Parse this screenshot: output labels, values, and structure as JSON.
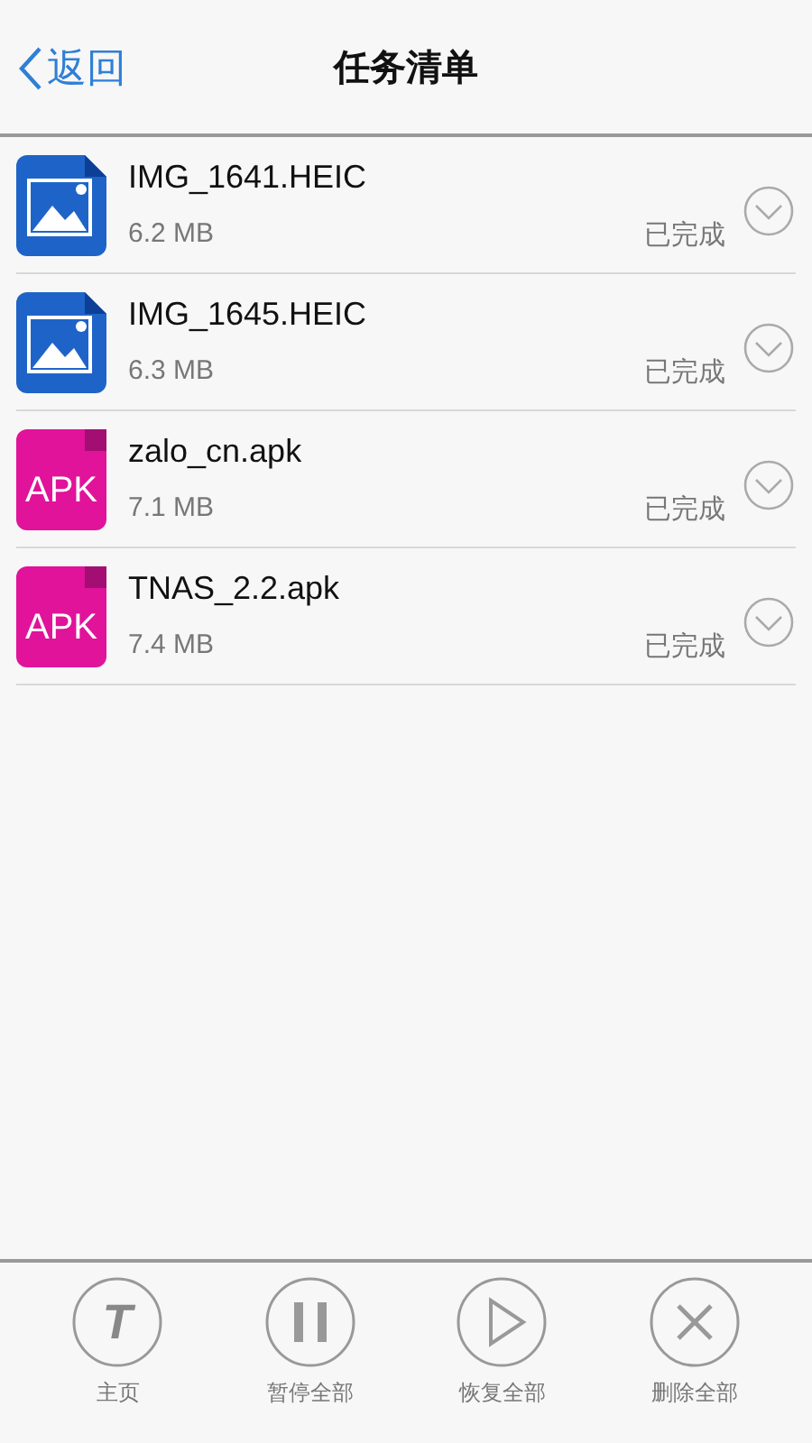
{
  "header": {
    "back": "返回",
    "title": "任务清单"
  },
  "tasks": [
    {
      "name": "IMG_1641.HEIC",
      "size": "6.2 MB",
      "status": "已完成",
      "kind": "image"
    },
    {
      "name": "IMG_1645.HEIC",
      "size": "6.3 MB",
      "status": "已完成",
      "kind": "image"
    },
    {
      "name": "zalo_cn.apk",
      "size": "7.1 MB",
      "status": "已完成",
      "kind": "apk",
      "badge": "APK"
    },
    {
      "name": "TNAS_2.2.apk",
      "size": "7.4 MB",
      "status": "已完成",
      "kind": "apk",
      "badge": "APK"
    }
  ],
  "toolbar": [
    {
      "label": "主页",
      "kind": "home",
      "glyph": "T"
    },
    {
      "label": "暂停全部",
      "kind": "pause"
    },
    {
      "label": "恢复全部",
      "kind": "play"
    },
    {
      "label": "删除全部",
      "kind": "delete"
    }
  ]
}
